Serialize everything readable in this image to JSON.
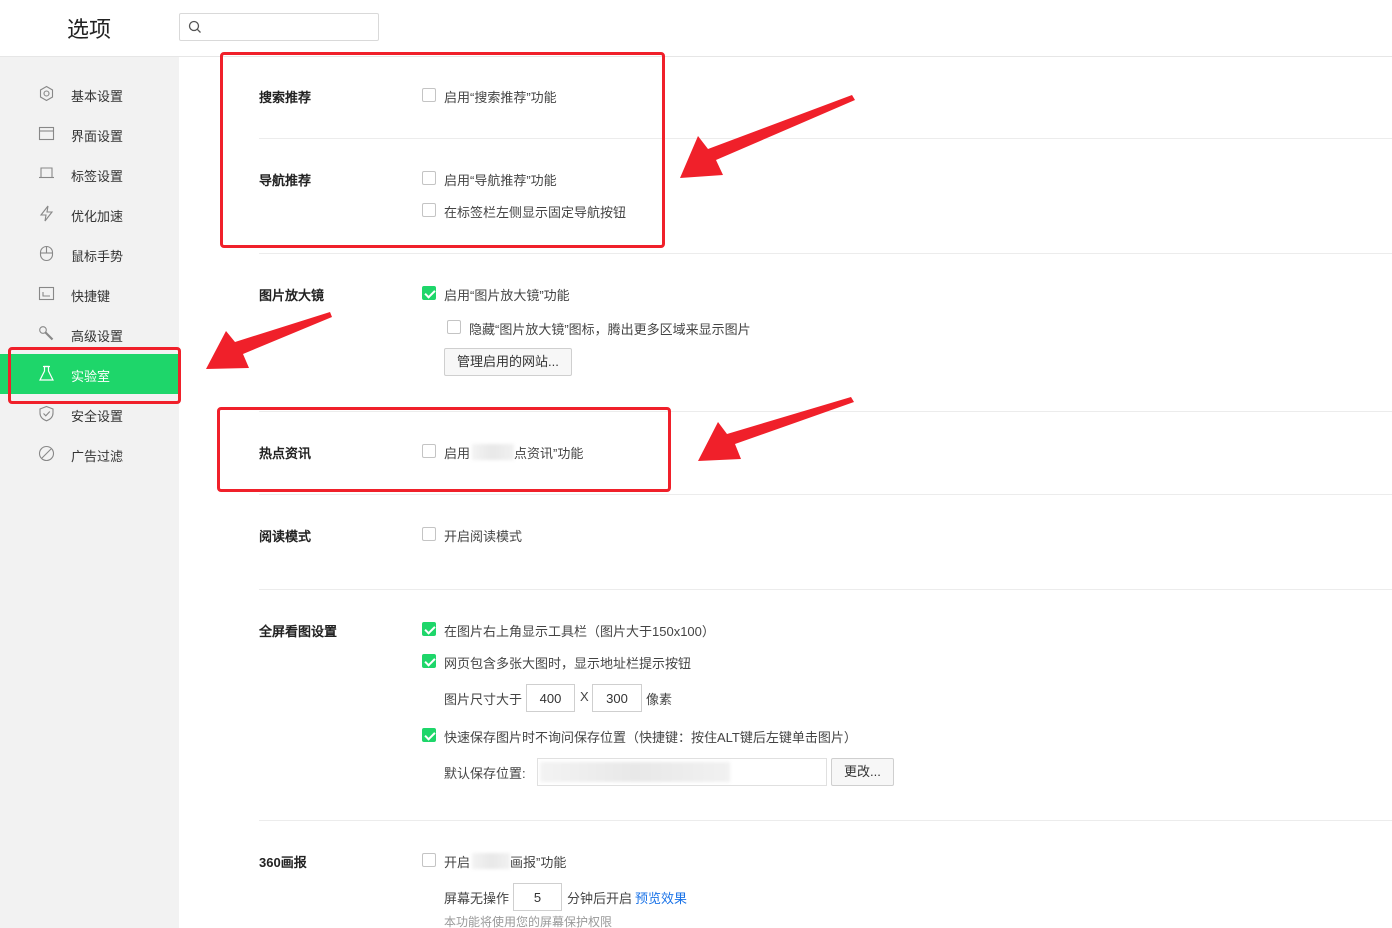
{
  "header": {
    "title": "选项",
    "search": {
      "placeholder": "",
      "value": ""
    }
  },
  "sidebar": {
    "items": [
      {
        "label": "基本设置",
        "icon": "gear-icon"
      },
      {
        "label": "界面设置",
        "icon": "window-icon"
      },
      {
        "label": "标签设置",
        "icon": "tab-icon"
      },
      {
        "label": "优化加速",
        "icon": "lightning-icon"
      },
      {
        "label": "鼠标手势",
        "icon": "mouse-icon"
      },
      {
        "label": "快捷键",
        "icon": "keyboard-icon"
      },
      {
        "label": "高级设置",
        "icon": "wrench-icon"
      },
      {
        "label": "实验室",
        "icon": "flask-icon",
        "active": true
      },
      {
        "label": "安全设置",
        "icon": "shield-icon"
      },
      {
        "label": "广告过滤",
        "icon": "block-icon"
      }
    ],
    "active_color": "#1ed66a"
  },
  "sections": {
    "search_rec": {
      "title": "搜索推荐",
      "opt1": {
        "label": "启用“搜索推荐”功能",
        "checked": false
      }
    },
    "nav_rec": {
      "title": "导航推荐",
      "opt1": {
        "label": "启用“导航推荐”功能",
        "checked": false
      },
      "opt2": {
        "label": "在标签栏左侧显示固定导航按钮",
        "checked": false
      }
    },
    "magnifier": {
      "title": "图片放大镜",
      "opt1": {
        "label": "启用“图片放大镜”功能",
        "checked": true
      },
      "opt2": {
        "label": "隐藏“图片放大镜”图标，腾出更多区域来显示图片",
        "checked": false
      },
      "button": "管理启用的网站..."
    },
    "hot_news": {
      "title": "热点资讯",
      "opt1": {
        "label_start": "启用",
        "label_end": "点资讯”功能",
        "checked": false
      }
    },
    "reading": {
      "title": "阅读模式",
      "opt1": {
        "label": "开启阅读模式",
        "checked": false
      }
    },
    "fullscreen": {
      "title": "全屏看图设置",
      "opt1": {
        "label": "在图片右上角显示工具栏（图片大于150x100）",
        "checked": true
      },
      "opt2": {
        "label": "网页包含多张大图时，显示地址栏提示按钮",
        "checked": true
      },
      "size_label": "图片尺寸大于",
      "width": "400",
      "x_sep": "X",
      "height": "300",
      "unit": "像素",
      "opt3": {
        "label": "快速保存图片时不询问保存位置（快捷键：按住ALT键后左键单击图片）",
        "checked": true
      },
      "save_label": "默认保存位置:",
      "change_button": "更改..."
    },
    "pictorial": {
      "title": "360画报",
      "opt1": {
        "label_start": "开启",
        "label_end": "画报”功能",
        "checked": false
      },
      "idle_label": "屏幕无操作",
      "minutes": "5",
      "after_label": "分钟后开启",
      "preview_link": "预览效果",
      "hint": "本功能将使用您的屏幕保护权限"
    }
  },
  "annotations": {
    "color": "#f0202a"
  }
}
